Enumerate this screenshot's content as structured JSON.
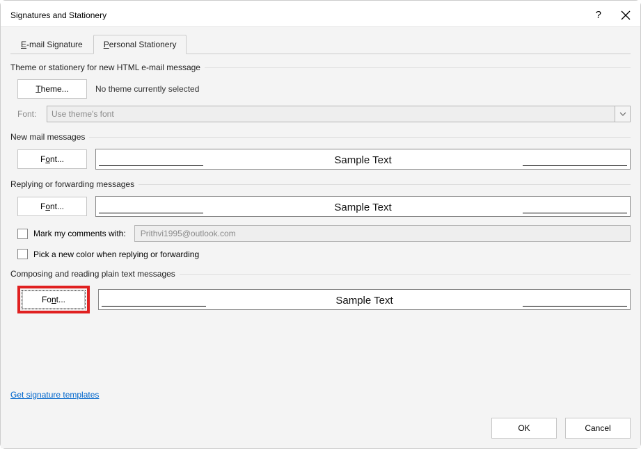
{
  "title": "Signatures and Stationery",
  "tabs": {
    "email": "E-mail Signature",
    "personal": "Personal Stationery"
  },
  "sections": {
    "theme": {
      "title": "Theme or stationery for new HTML e-mail message",
      "theme_btn": "Theme...",
      "theme_hint": "No theme currently selected",
      "font_label": "Font:",
      "font_value": "Use theme's font"
    },
    "new_mail": {
      "title": "New mail messages",
      "font_btn": "Font...",
      "sample": "Sample Text"
    },
    "reply": {
      "title": "Replying or forwarding messages",
      "font_btn": "Font...",
      "sample": "Sample Text",
      "mark_label": "Mark my comments with:",
      "mark_value": "Prithvi1995@outlook.com",
      "pick_color": "Pick a new color when replying or forwarding"
    },
    "plain": {
      "title": "Composing and reading plain text messages",
      "font_btn": "Font...",
      "sample": "Sample Text"
    }
  },
  "link": "Get signature templates",
  "footer": {
    "ok": "OK",
    "cancel": "Cancel"
  }
}
